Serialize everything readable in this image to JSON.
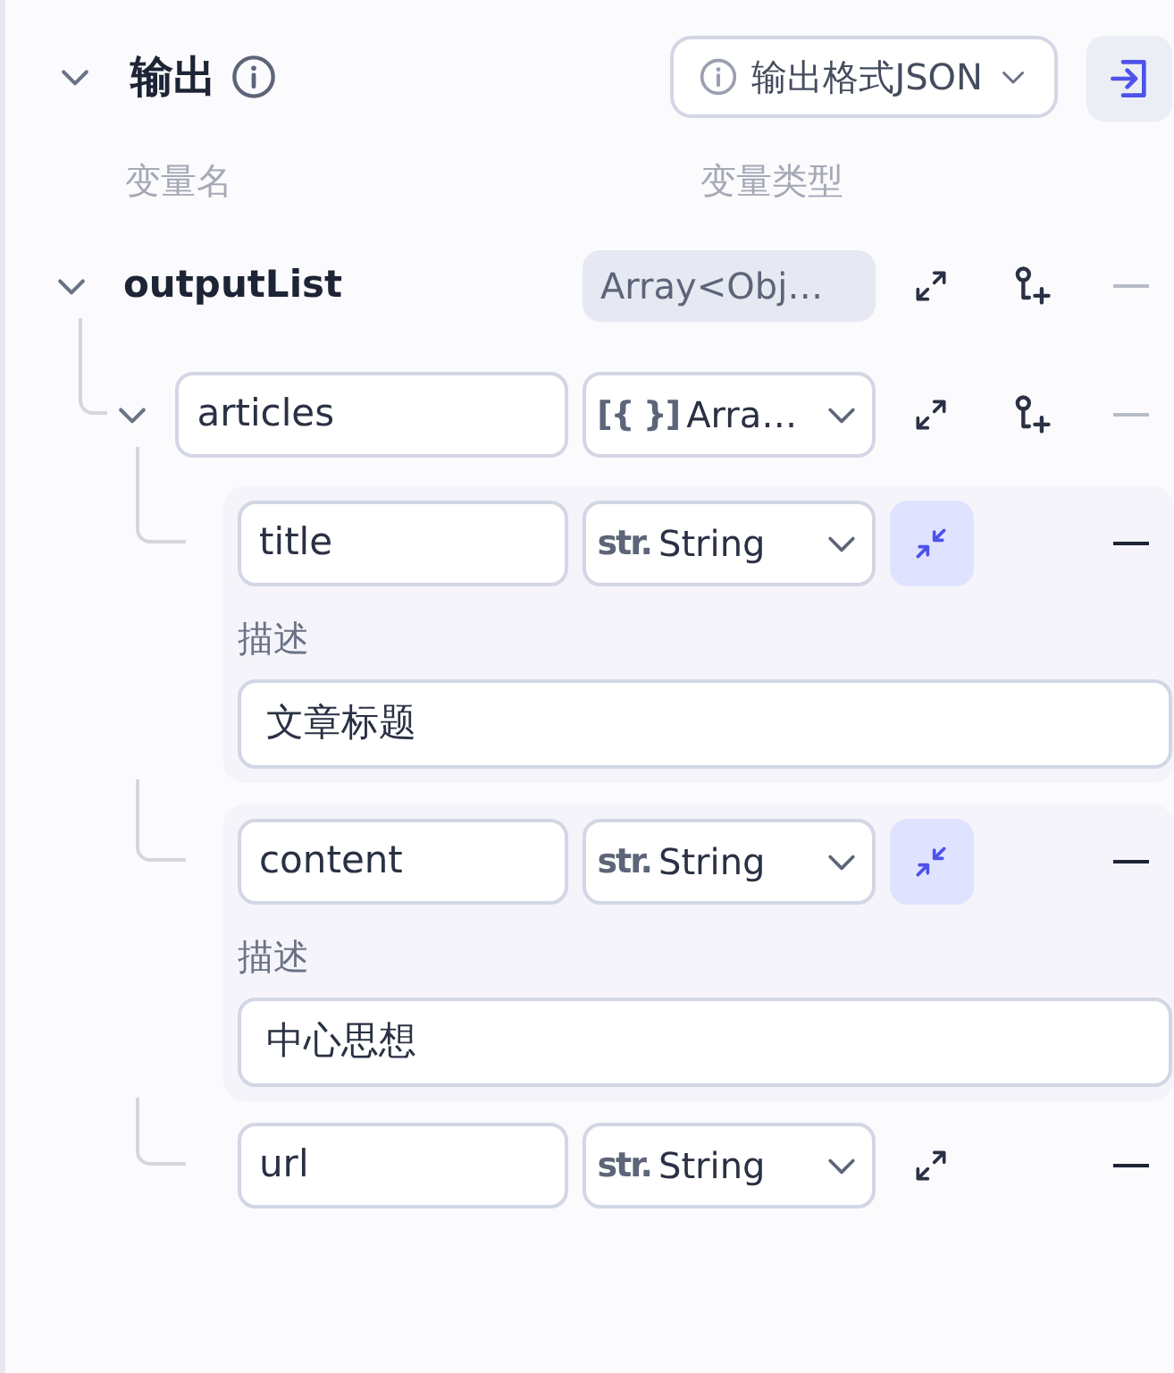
{
  "section": {
    "title": "输出",
    "expanded": true
  },
  "format_select": {
    "value": "输出格式JSON"
  },
  "columns": [
    "变量名",
    "变量类型"
  ],
  "variables": [
    {
      "name": "outputList",
      "editable": false,
      "type": "Array<Obj…",
      "expanded": true,
      "children": [
        {
          "name": "articles",
          "editable": true,
          "type_prefix": "[{ }]",
          "type": "Arra…",
          "expanded": true,
          "children": [
            {
              "name": "title",
              "editable": true,
              "type_prefix": "str.",
              "type": "String",
              "desc_expanded": true,
              "description_label": "描述",
              "description": "文章标题"
            },
            {
              "name": "content",
              "editable": true,
              "type_prefix": "str.",
              "type": "String",
              "desc_expanded": true,
              "description_label": "描述",
              "description": "中心思想"
            },
            {
              "name": "url",
              "editable": true,
              "type_prefix": "str.",
              "type": "String",
              "desc_expanded": false
            }
          ]
        }
      ]
    }
  ]
}
